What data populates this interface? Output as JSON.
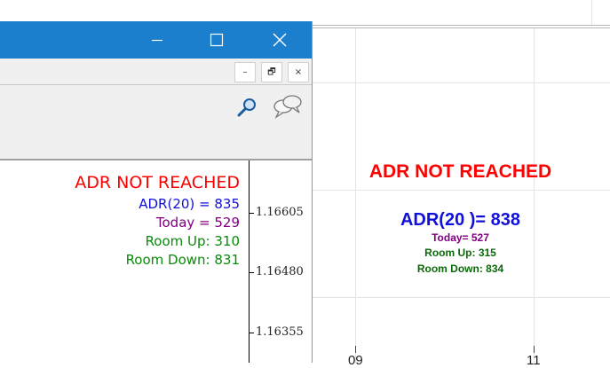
{
  "background_chart": {
    "overlay": {
      "title": "ADR NOT REACHED",
      "adr": "ADR(20 )= 838",
      "today": "Today= 527",
      "room_up": "Room Up: 315",
      "room_down": "Room Down: 834"
    },
    "x_labels": [
      "09",
      "11"
    ]
  },
  "window": {
    "titlebar": {
      "minimize_icon": "minimize-icon",
      "maximize_icon": "maximize-icon",
      "close_icon": "close-icon"
    },
    "mdi_controls": {
      "minimize": "–",
      "restore": "🗗",
      "close": "×"
    },
    "toolbar": {
      "icons": [
        "search-icon",
        "chat-icon"
      ]
    },
    "chart": {
      "overlay": {
        "title": "ADR NOT REACHED",
        "adr": "ADR(20) = 835",
        "today": "Today = 529",
        "room_up": "Room Up: 310",
        "room_down": "Room Down: 831"
      },
      "price_axis": [
        "1.16605",
        "1.16480",
        "1.16355"
      ]
    }
  },
  "colors": {
    "titlebar": "#1b7fcd",
    "alert": "#ff0000",
    "adr": "#1010d8",
    "today": "#800080",
    "room": "#0a8a0a"
  }
}
